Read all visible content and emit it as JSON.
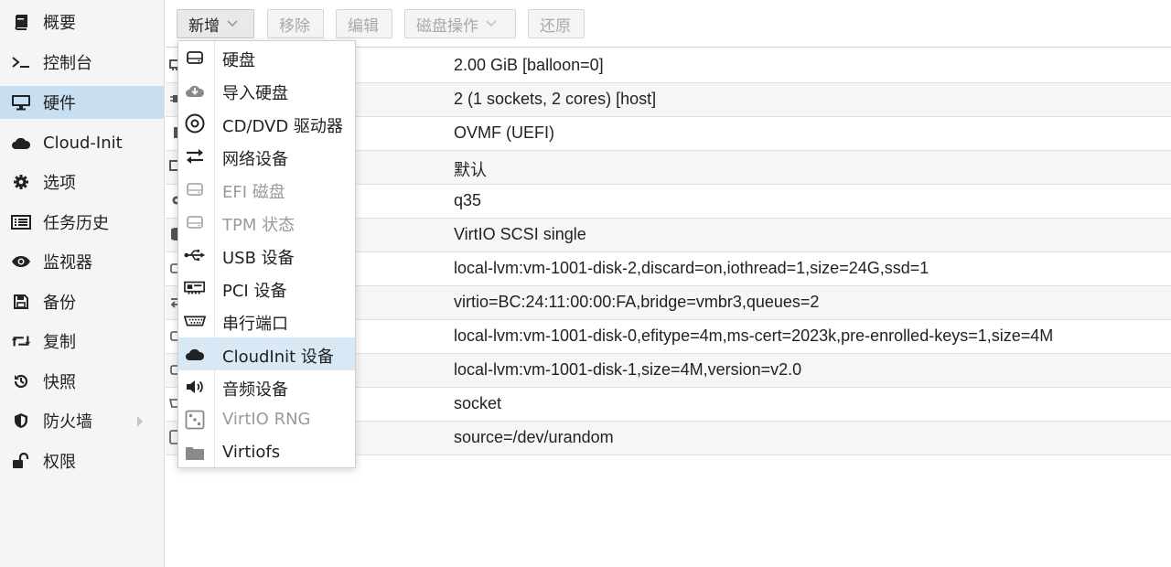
{
  "sidebar": {
    "items": [
      {
        "label": "概要",
        "icon": "book-icon"
      },
      {
        "label": "控制台",
        "icon": "terminal-icon"
      },
      {
        "label": "硬件",
        "icon": "monitor-icon",
        "active": true
      },
      {
        "label": "Cloud-Init",
        "icon": "cloud-icon"
      },
      {
        "label": "选项",
        "icon": "gear-icon"
      },
      {
        "label": "任务历史",
        "icon": "list-icon"
      },
      {
        "label": "监视器",
        "icon": "eye-icon"
      },
      {
        "label": "备份",
        "icon": "floppy-icon"
      },
      {
        "label": "复制",
        "icon": "retweet-icon"
      },
      {
        "label": "快照",
        "icon": "history-icon"
      },
      {
        "label": "防火墙",
        "icon": "shield-icon"
      },
      {
        "label": "权限",
        "icon": "unlock-icon"
      }
    ]
  },
  "toolbar": {
    "add_label": "新增",
    "remove_label": "移除",
    "edit_label": "编辑",
    "disk_action_label": "磁盘操作",
    "revert_label": "还原"
  },
  "hardware": {
    "values": [
      "2.00 GiB [balloon=0]",
      "2 (1 sockets, 2 cores) [host]",
      "OVMF (UEFI)",
      "默认",
      "q35",
      "VirtIO SCSI single",
      "local-lvm:vm-1001-disk-2,discard=on,iothread=1,size=24G,ssd=1",
      "virtio=BC:24:11:00:00:FA,bridge=vmbr3,queues=2",
      "local-lvm:vm-1001-disk-0,efitype=4m,ms-cert=2023k,pre-enrolled-keys=1,size=4M",
      "local-lvm:vm-1001-disk-1,size=4M,version=v2.0",
      "socket",
      "source=/dev/urandom"
    ]
  },
  "add_menu": {
    "items": [
      {
        "label": "硬盘",
        "icon": "hdd-icon",
        "enabled": true
      },
      {
        "label": "导入硬盘",
        "icon": "cloud-download-icon",
        "enabled": true
      },
      {
        "label": "CD/DVD 驱动器",
        "icon": "optical-disc-icon",
        "enabled": true
      },
      {
        "label": "网络设备",
        "icon": "exchange-icon",
        "enabled": true
      },
      {
        "label": "EFI 磁盘",
        "icon": "hdd-icon",
        "enabled": false
      },
      {
        "label": "TPM 状态",
        "icon": "hdd-icon",
        "enabled": false
      },
      {
        "label": "USB 设备",
        "icon": "usb-icon",
        "enabled": true
      },
      {
        "label": "PCI 设备",
        "icon": "pci-card-icon",
        "enabled": true
      },
      {
        "label": "串行端口",
        "icon": "serial-port-icon",
        "enabled": true
      },
      {
        "label": "CloudInit 设备",
        "icon": "cloud-icon",
        "enabled": true,
        "highlighted": true
      },
      {
        "label": "音频设备",
        "icon": "speaker-icon",
        "enabled": true
      },
      {
        "label": "VirtIO RNG",
        "icon": "dice-icon",
        "enabled": false
      },
      {
        "label": "Virtiofs",
        "icon": "folder-icon",
        "enabled": true
      }
    ]
  },
  "colors": {
    "active_bg": "#c7dff1",
    "menu_highlight": "#d8e8f5",
    "disabled_text": "#9a9a9a"
  }
}
